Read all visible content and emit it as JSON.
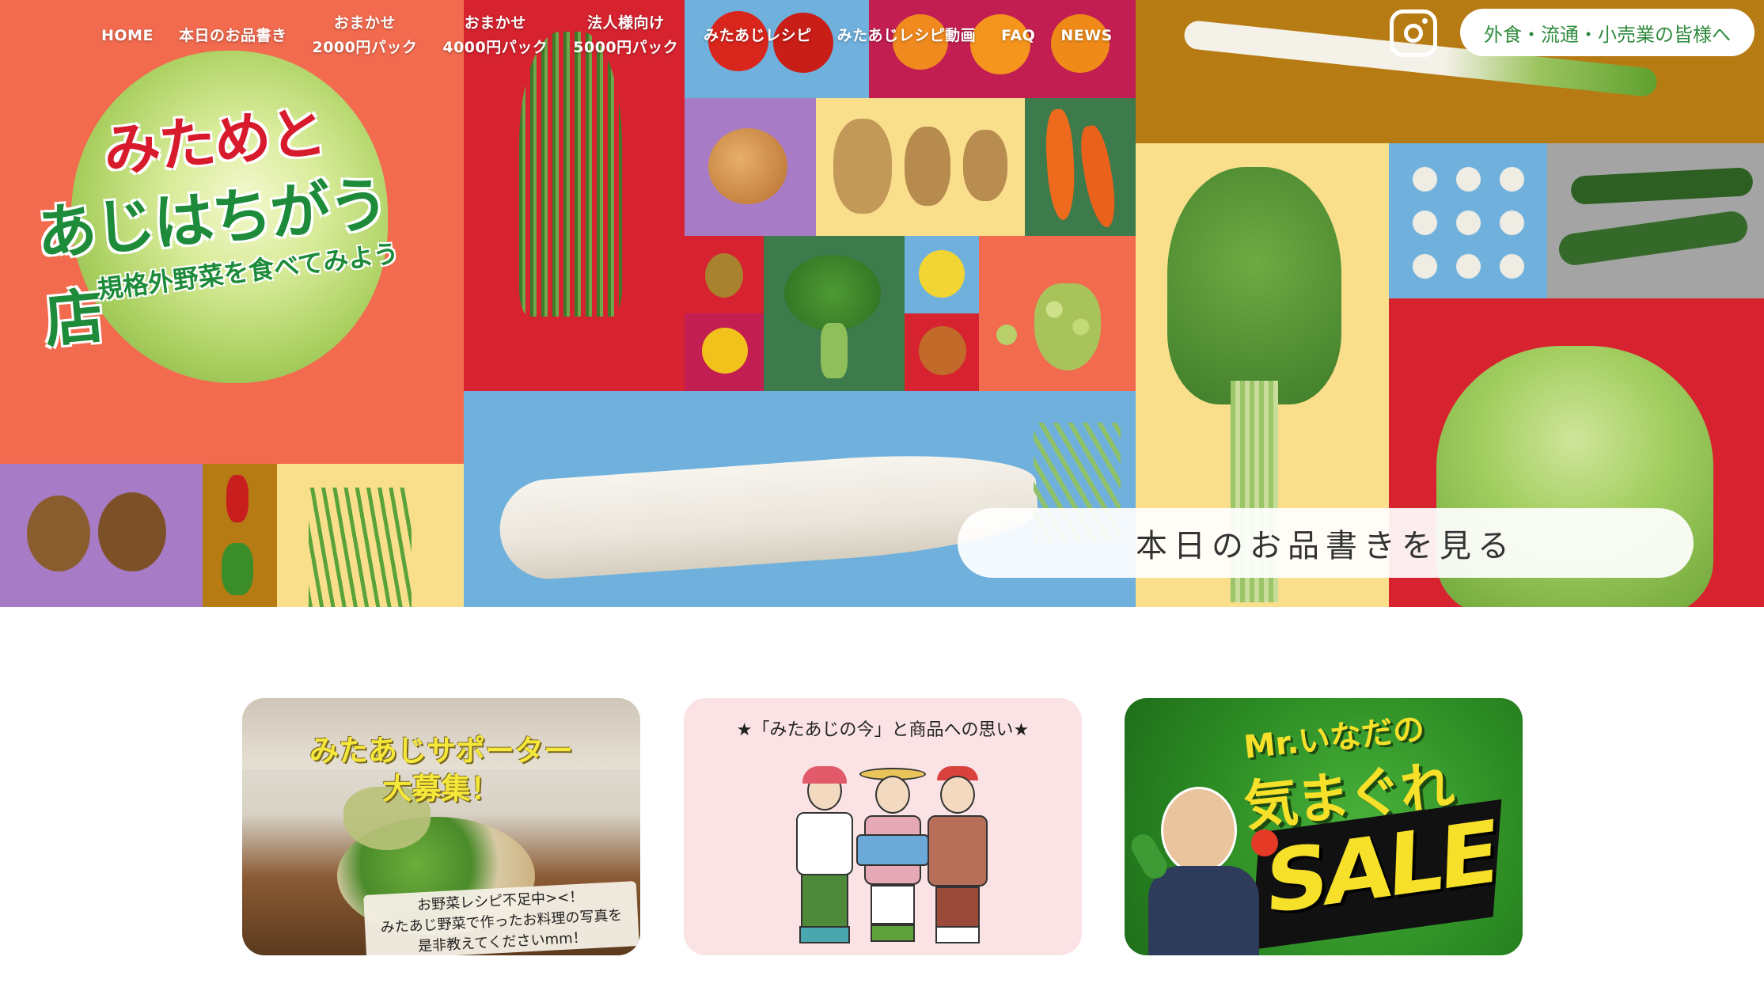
{
  "nav": {
    "items": [
      {
        "label": "HOME"
      },
      {
        "label": "本日のお品書き"
      },
      {
        "label": "おまかせ\n2000円パック"
      },
      {
        "label": "おまかせ\n4000円パック"
      },
      {
        "label": "法人様向け\n5000円パック"
      },
      {
        "label": "みたあじレシピ"
      },
      {
        "label": "みたあじレシピ動画"
      },
      {
        "label": "FAQ"
      },
      {
        "label": "NEWS"
      }
    ],
    "instagram_icon": "instagram-icon",
    "business_button": "外食・流通・小売業の皆様へ"
  },
  "logo": {
    "line1": "みためと",
    "line2": "あじはちがう店",
    "tagline": "規格外野菜を食べてみよう"
  },
  "hero": {
    "cta_label": "本日のお品書きを見る"
  },
  "banners": [
    {
      "title_line1": "みたあじサポーター",
      "title_line2": "大募集！",
      "note_line1": "お野菜レシピ不足中><！",
      "note_line2": "みたあじ野菜で作ったお料理の写真を",
      "note_line3": "是非教えてくださいmm！"
    },
    {
      "title": "★「みたあじの今」と商品への思い★"
    },
    {
      "title_line1": "Mr.いなだの",
      "title_line2": "気まぐれ",
      "sale": "SALE"
    }
  ],
  "colors": {
    "brand_green": "#2f8a3e",
    "logo_red": "#d81b2c",
    "tile_coral": "#f26b4f",
    "tile_red": "#d6232f",
    "tile_blue": "#6fb1dc",
    "tile_yellow": "#f9df8c",
    "tile_purple": "#a77bc6",
    "tile_ochre": "#b77b14",
    "tile_green": "#3d7a4c"
  }
}
